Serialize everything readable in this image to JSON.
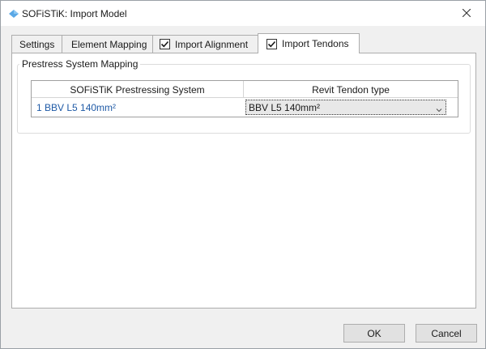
{
  "window": {
    "title": "SOFiSTiK: Import Model",
    "title_icon": "sofistik-diamond-icon",
    "close_icon": "close-icon"
  },
  "tabs": [
    {
      "label": "Settings",
      "has_checkbox": false,
      "active": false
    },
    {
      "label": "Element Mapping",
      "has_checkbox": false,
      "active": false
    },
    {
      "label": "Import Alignment",
      "has_checkbox": true,
      "checked": true,
      "active": false
    },
    {
      "label": "Import Tendons",
      "has_checkbox": true,
      "checked": true,
      "active": true
    }
  ],
  "group": {
    "legend": "Prestress System Mapping"
  },
  "grid": {
    "columns": [
      "SOFiSTiK Prestressing System",
      "Revit Tendon type"
    ],
    "rows": [
      {
        "system": "1 BBV L5 140mm²",
        "tendon_type": "BBV L5 140mm²"
      }
    ]
  },
  "buttons": {
    "ok": "OK",
    "cancel": "Cancel"
  },
  "colors": {
    "accent_text": "#1f5aa6",
    "title_icon": "#5aa8e6"
  }
}
